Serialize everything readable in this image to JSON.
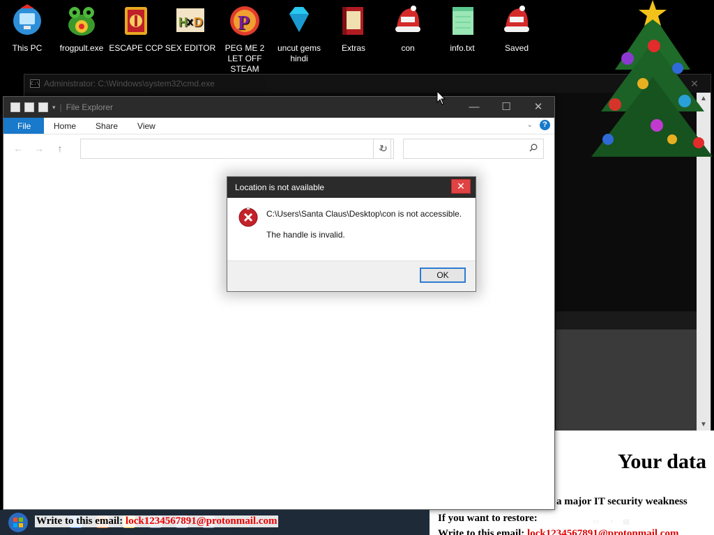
{
  "desktop": {
    "icons": [
      {
        "label": "This PC",
        "icon": "computer-icon",
        "color": "#3aa0e8"
      },
      {
        "label": "frogpult.exe",
        "icon": "frog-icon",
        "color": "#3c9a2b"
      },
      {
        "label": "ESCAPE CCP",
        "icon": "lantern-icon",
        "color": "#e0a020"
      },
      {
        "label": "SEX EDITOR",
        "icon": "hxd-icon",
        "color": "#d8b060"
      },
      {
        "label": "PEG ME 2 LET OFF STEAM",
        "icon": "p-logo-icon",
        "color": "#e23c2c"
      },
      {
        "label": "uncut gems hindi",
        "icon": "gem-icon",
        "color": "#28c8f0"
      },
      {
        "label": "Extras",
        "icon": "book-icon",
        "color": "#c8242a"
      },
      {
        "label": "con",
        "icon": "santa-hat-icon",
        "color": "#d42a2a"
      },
      {
        "label": "info.txt",
        "icon": "notepad-icon",
        "color": "#7fd6a0"
      },
      {
        "label": "Saved",
        "icon": "santa-hat-icon",
        "color": "#d42a2a"
      }
    ]
  },
  "cmd_window": {
    "title": "Administrator: C:\\Windows\\system32\\cmd.exe"
  },
  "explorer": {
    "title": "File Explorer",
    "tabs": [
      "File",
      "Home",
      "Share",
      "View"
    ],
    "help": "?",
    "accent": "#1979ca"
  },
  "dialog": {
    "title": "Location is not available",
    "message": "C:\\Users\\Santa Claus\\Desktop\\con is not accessible.",
    "detail": "The handle is invalid.",
    "ok_label": "OK",
    "close_glyph": "✕"
  },
  "ransom": {
    "heading": "Your data",
    "line": "a major IT security weakness",
    "restore": "If you want to restore:",
    "write_prefix": "Write to this email: ",
    "email": "lock1234567891@protonmail.com"
  },
  "taskbar": {
    "overlay_prefix": "Write to this email: ",
    "overlay_email": "lock1234567891@protonmail.com"
  }
}
